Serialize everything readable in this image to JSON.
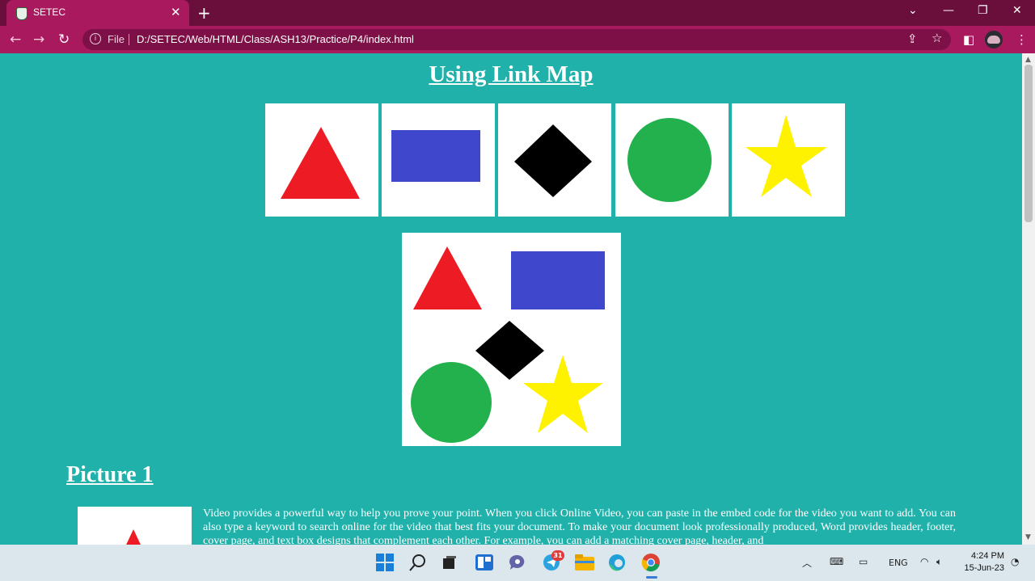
{
  "browser": {
    "tab_title": "SETEC",
    "tab_close": "✕",
    "new_tab": "+",
    "file_label": "File",
    "url": "D:/SETEC/Web/HTML/Class/ASH13/Practice/P4/index.html"
  },
  "page": {
    "heading": "Using Link Map",
    "shapes": [
      "triangle",
      "rectangle",
      "diamond",
      "circle",
      "star"
    ],
    "colors": {
      "background": "#20b2aa",
      "triangle": "#ed1c24",
      "rectangle": "#3f48cc",
      "diamond": "#000000",
      "circle": "#22b14c",
      "star": "#fff200"
    },
    "picture_heading": "Picture 1",
    "paragraph": "Video provides a powerful way to help you prove your point. When you click Online Video, you can paste in the embed code for the video you want to add. You can also type a keyword to search online for the video that best fits your document. To make your document look professionally produced, Word provides header, footer, cover page, and text box designs that complement each other. For example, you can add a matching cover page, header, and"
  },
  "taskbar": {
    "badge_count": "31",
    "language": "ENG",
    "time": "4:24 PM",
    "date": "15-Jun-23"
  }
}
